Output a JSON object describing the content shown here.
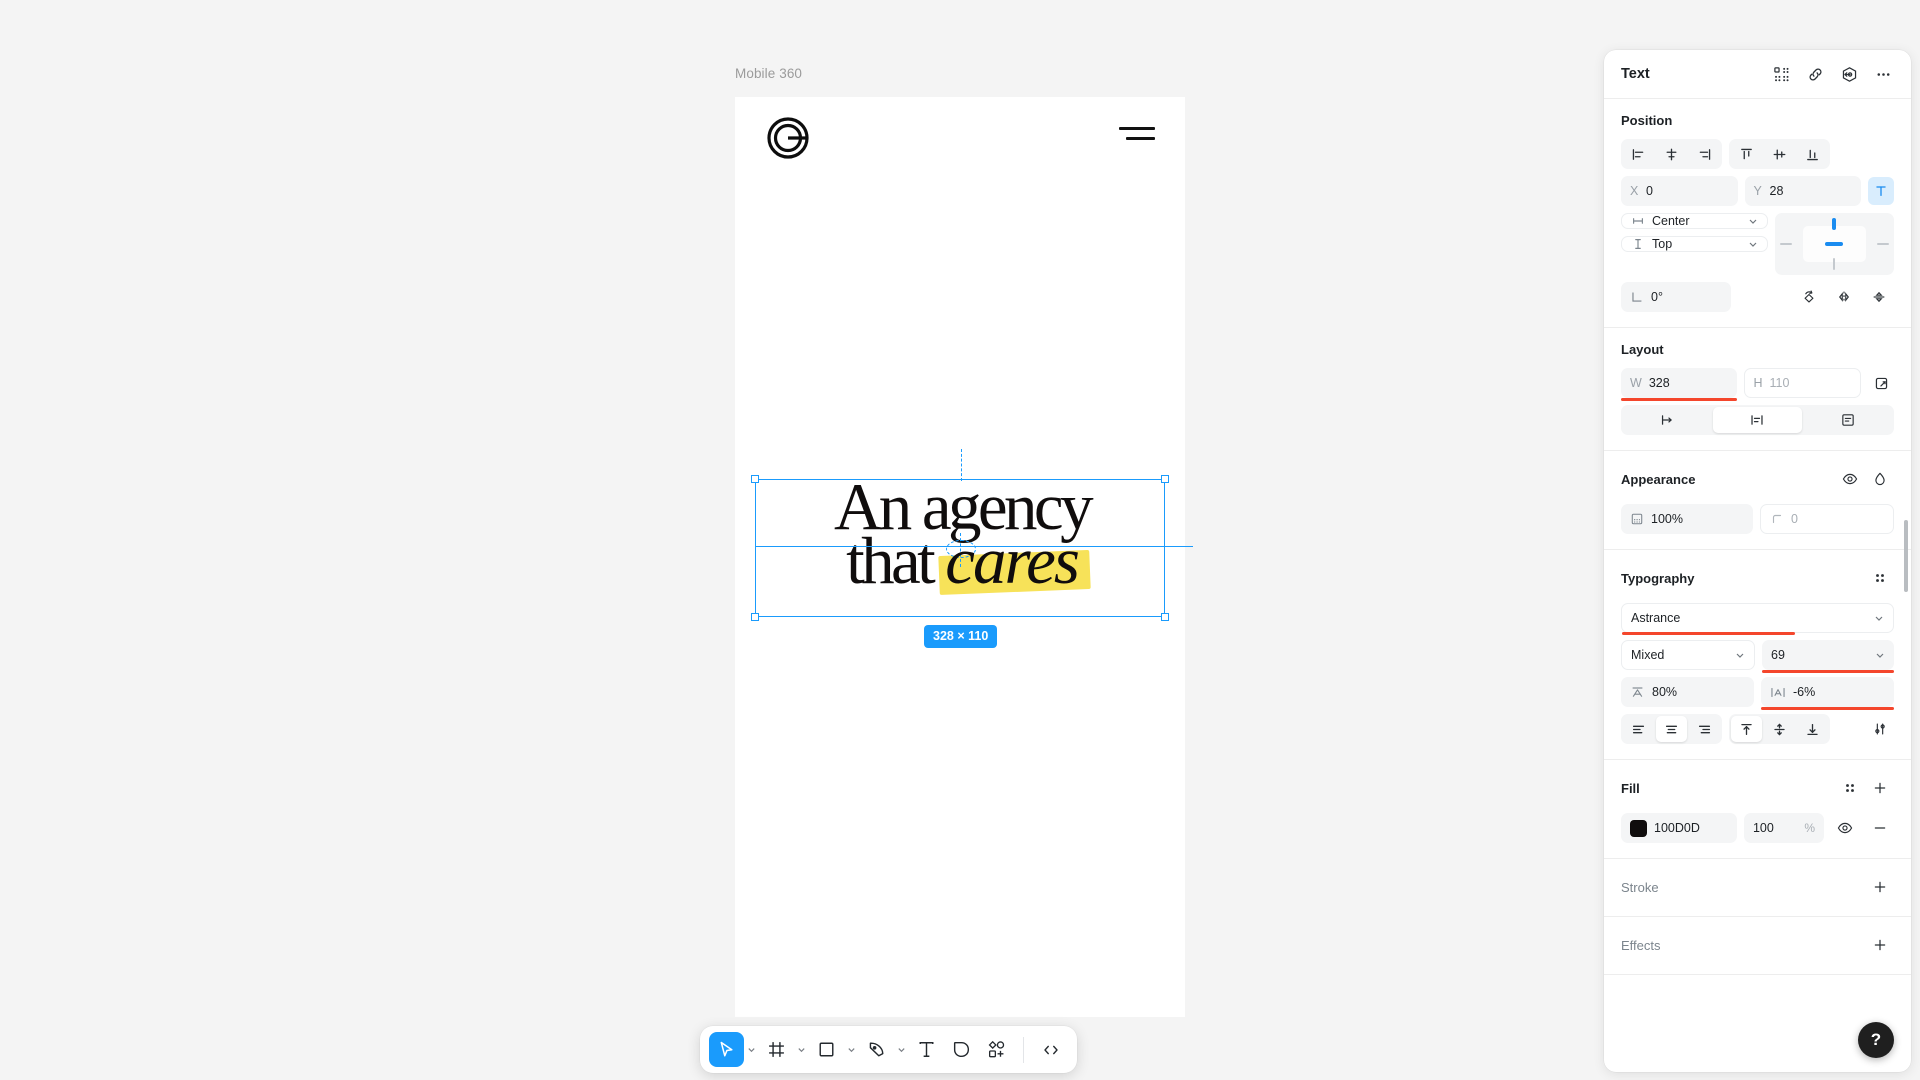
{
  "canvas": {
    "frame_label": "Mobile 360",
    "headline": {
      "line1": "An agency",
      "line2_prefix": "that ",
      "line2_highlight": "cares",
      "highlight_color": "#f7e259",
      "text_color": "#100D0D"
    },
    "selection": {
      "size_badge": "328 × 110",
      "accent_color": "#1A9BFC"
    }
  },
  "toolbar": {
    "items": [
      {
        "name": "cursor-tool",
        "icon": "cursor-icon",
        "active": true,
        "caret": true
      },
      {
        "name": "frame-tool",
        "icon": "frame-icon",
        "active": false,
        "caret": true
      },
      {
        "name": "rectangle-tool",
        "icon": "rectangle-icon",
        "active": false,
        "caret": true
      },
      {
        "name": "pen-tool",
        "icon": "pen-icon",
        "active": false,
        "caret": true
      },
      {
        "name": "text-tool",
        "icon": "text-icon",
        "active": false,
        "caret": false
      },
      {
        "name": "shape-tool",
        "icon": "ellipse-icon",
        "active": false,
        "caret": false
      },
      {
        "name": "component-tool",
        "icon": "component-add-icon",
        "active": false,
        "caret": false
      }
    ],
    "code_button": {
      "name": "code-button",
      "icon": "code-icon",
      "label": "</>"
    }
  },
  "panel": {
    "title": "Text",
    "header_icons": [
      "components-icon",
      "link-icon",
      "export-icon",
      "more-icon"
    ],
    "position": {
      "title": "Position",
      "align_horizontal": [
        "align-left-icon",
        "align-center-h-icon",
        "align-right-icon"
      ],
      "align_vertical": [
        "align-top-icon",
        "align-center-v-icon",
        "align-bottom-icon"
      ],
      "x": {
        "label": "X",
        "value": "0"
      },
      "y": {
        "label": "Y",
        "value": "28"
      },
      "text_resize_active": true,
      "horizontal_constraint": "Center",
      "vertical_constraint": "Top",
      "rotation": "0°",
      "transform_icons": [
        "rotate-icon",
        "flip-horizontal-icon",
        "flip-vertical-icon"
      ]
    },
    "layout": {
      "title": "Layout",
      "width": {
        "label": "W",
        "value": "328",
        "modified": true
      },
      "height": {
        "label": "H",
        "value": "110",
        "modified": false
      },
      "constrain_icon": "constrain-proportions-icon",
      "resize_modes": [
        "fixed-width-icon",
        "hug-contents-icon",
        "auto-height-icon"
      ],
      "resize_active_index": 1
    },
    "appearance": {
      "title": "Appearance",
      "icons": [
        "visibility-icon",
        "blend-mode-icon"
      ],
      "opacity": {
        "value": "100%",
        "icon": "opacity-icon"
      },
      "corner_radius": {
        "value": "0",
        "icon": "corner-radius-icon"
      }
    },
    "typography": {
      "title": "Typography",
      "settings_icon": "type-settings-icon",
      "font_family": {
        "value": "Astrance",
        "modified": true
      },
      "font_weight": {
        "value": "Mixed"
      },
      "font_size": {
        "value": "69",
        "modified": true
      },
      "line_height": {
        "value": "80%",
        "icon": "line-height-icon"
      },
      "letter_spacing": {
        "value": "-6%",
        "icon": "letter-spacing-icon",
        "modified": true
      },
      "text_align": [
        "text-align-left-icon",
        "text-align-center-icon",
        "text-align-right-icon"
      ],
      "text_align_active_index": 1,
      "vertical_align": [
        "v-align-top-icon",
        "v-align-middle-icon",
        "v-align-bottom-icon"
      ],
      "vertical_align_active_index": 0,
      "advanced_icon": "sliders-icon"
    },
    "fill": {
      "title": "Fill",
      "actions": [
        "styles-icon",
        "add-icon"
      ],
      "color_hex": "100D0D",
      "color_value": "#100D0D",
      "opacity": "100",
      "opacity_unit": "%",
      "row_icons": [
        "visibility-icon",
        "remove-icon"
      ]
    },
    "stroke": {
      "title": "Stroke",
      "action": "add-icon"
    },
    "effects": {
      "title": "Effects",
      "action": "add-icon"
    }
  },
  "help": {
    "label": "?"
  }
}
